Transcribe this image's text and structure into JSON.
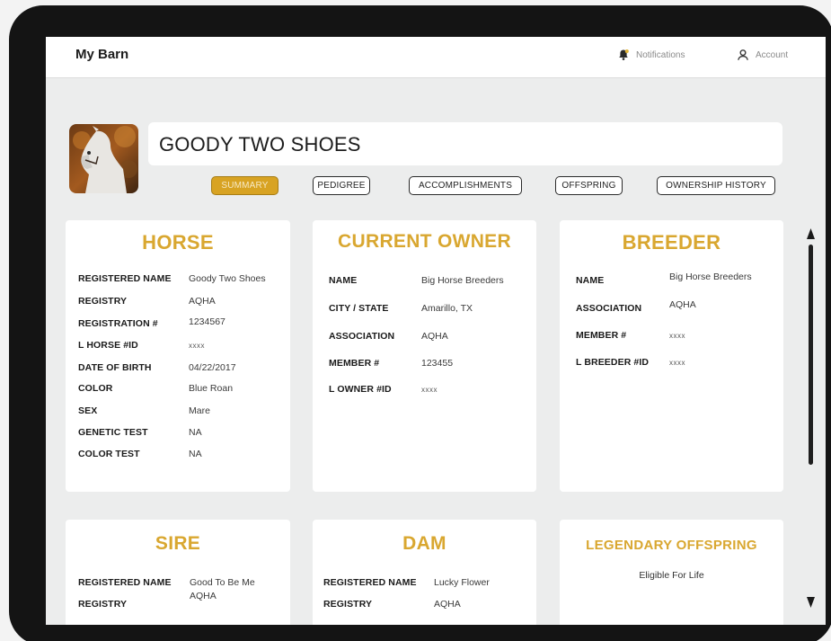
{
  "app": {
    "title": "My Barn"
  },
  "nav": {
    "notifications": "Notifications",
    "account": "Account"
  },
  "horse_header": {
    "name": "GOODY TWO SHOES"
  },
  "tabs": [
    {
      "label": "SUMMARY",
      "active": true
    },
    {
      "label": "PEDIGREE",
      "active": false
    },
    {
      "label": "ACCOMPLISHMENTS",
      "active": false
    },
    {
      "label": "OFFSPRING",
      "active": false
    },
    {
      "label": "OWNERSHIP HISTORY",
      "active": false
    }
  ],
  "horse": {
    "title": "HORSE",
    "rows": [
      {
        "label": "REGISTERED NAME",
        "value": "Goody Two Shoes"
      },
      {
        "label": "REGISTRY",
        "value": "AQHA"
      },
      {
        "label": "REGISTRATION #",
        "value": "1234567"
      },
      {
        "label": "L HORSE #ID",
        "value": "xxxx"
      },
      {
        "label": "DATE OF BIRTH",
        "value": "04/22/2017"
      },
      {
        "label": "COLOR",
        "value": "Blue Roan"
      },
      {
        "label": "SEX",
        "value": "Mare"
      },
      {
        "label": "GENETIC TEST",
        "value": "NA"
      },
      {
        "label": "COLOR TEST",
        "value": "NA"
      }
    ]
  },
  "owner": {
    "title": "CURRENT OWNER",
    "rows": [
      {
        "label": "NAME",
        "value": "Big Horse Breeders"
      },
      {
        "label": "CITY / STATE",
        "value": "Amarillo, TX"
      },
      {
        "label": "ASSOCIATION",
        "value": "AQHA"
      },
      {
        "label": "MEMBER #",
        "value": "123455"
      },
      {
        "label": "L OWNER #ID",
        "value": "xxxx"
      }
    ]
  },
  "breeder": {
    "title": "BREEDER",
    "rows": [
      {
        "label": "NAME",
        "value": "Big Horse Breeders"
      },
      {
        "label": "ASSOCIATION",
        "value": "AQHA"
      },
      {
        "label": "MEMBER #",
        "value": "xxxx"
      },
      {
        "label": "L BREEDER #ID",
        "value": "xxxx"
      }
    ]
  },
  "sire": {
    "title": "SIRE",
    "rows": [
      {
        "label": "REGISTERED NAME",
        "value": "Good To Be Me"
      },
      {
        "label": "REGISTRY",
        "value": "AQHA"
      }
    ]
  },
  "dam": {
    "title": "DAM",
    "rows": [
      {
        "label": "REGISTERED NAME",
        "value": "Lucky Flower"
      },
      {
        "label": "REGISTRY",
        "value": "AQHA"
      }
    ]
  },
  "legendary": {
    "title": "LEGENDARY OFFSPRING",
    "text": "Eligible For Life"
  },
  "colors": {
    "accent": "#d9a730",
    "tab_active": "#d8a323",
    "frame": "#141414"
  },
  "icons": {
    "notifications": "bell-icon",
    "account": "user-icon",
    "scroll_up": "triangle-up-icon",
    "scroll_down": "triangle-down-icon"
  }
}
